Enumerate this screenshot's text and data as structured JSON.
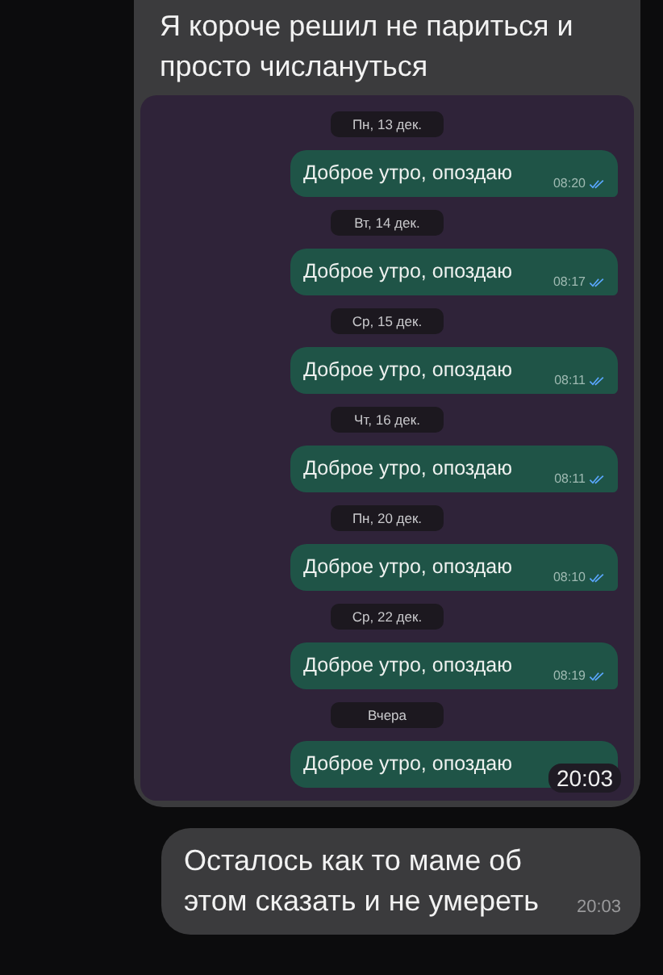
{
  "messages": [
    {
      "kind": "screenshot",
      "text": "Я короче решил не париться и просто числануться",
      "overlay_time": "20:03",
      "screenshot": {
        "items": [
          {
            "kind": "date",
            "text": "Пн, 13 дек."
          },
          {
            "kind": "message",
            "text": "Доброе утро, опоздаю",
            "time": "08:20",
            "read": true
          },
          {
            "kind": "date",
            "text": "Вт, 14 дек."
          },
          {
            "kind": "message",
            "text": "Доброе утро, опоздаю",
            "time": "08:17",
            "read": true
          },
          {
            "kind": "date",
            "text": "Ср, 15 дек."
          },
          {
            "kind": "message",
            "text": "Доброе утро, опоздаю",
            "time": "08:11",
            "read": true
          },
          {
            "kind": "date",
            "text": "Чт, 16 дек."
          },
          {
            "kind": "message",
            "text": "Доброе утро, опоздаю",
            "time": "08:11",
            "read": true
          },
          {
            "kind": "date",
            "text": "Пн, 20 дек."
          },
          {
            "kind": "message",
            "text": "Доброе утро, опоздаю",
            "time": "08:10",
            "read": true
          },
          {
            "kind": "date",
            "text": "Ср, 22 дек."
          },
          {
            "kind": "message",
            "text": "Доброе утро, опоздаю",
            "time": "08:19",
            "read": true
          },
          {
            "kind": "date",
            "text": "Вчера"
          },
          {
            "kind": "message",
            "text": "Доброе утро, опоздаю"
          }
        ]
      }
    },
    {
      "kind": "text",
      "text": "Осталось как то маме об этом сказать и не умереть",
      "time": "20:03"
    }
  ]
}
